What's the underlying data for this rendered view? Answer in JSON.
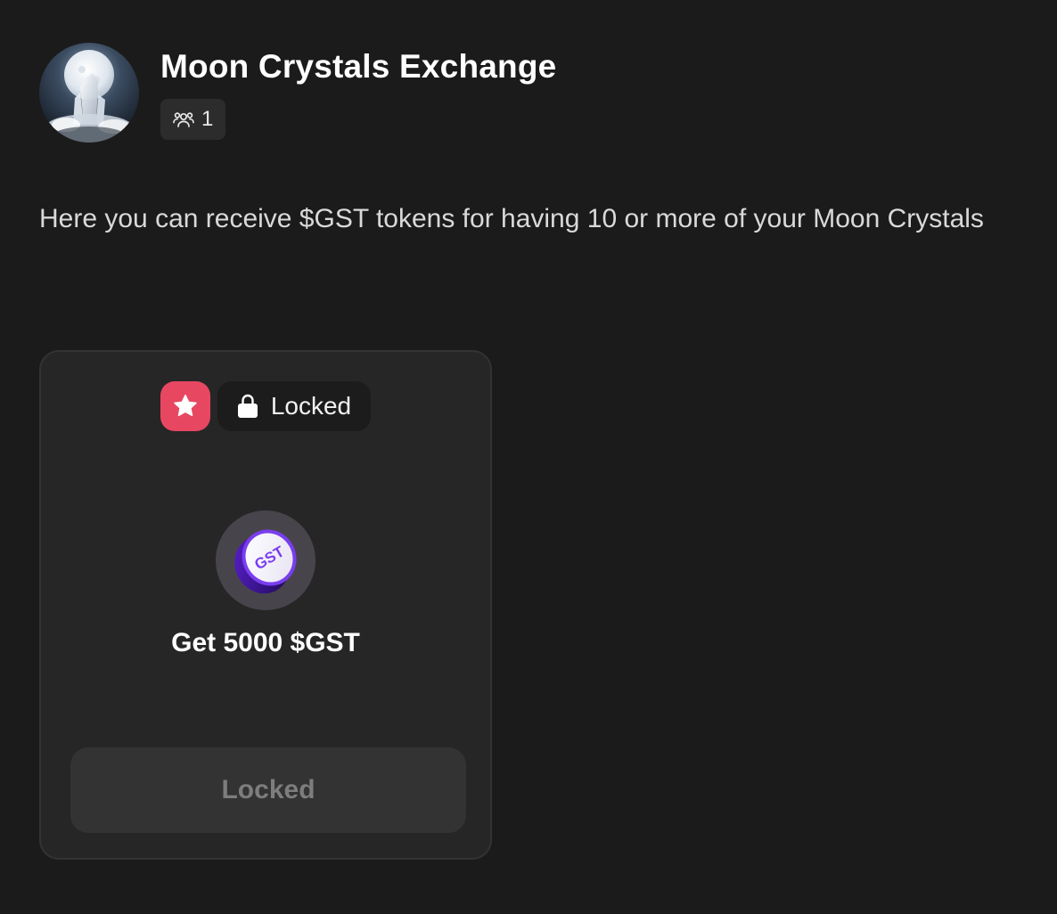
{
  "header": {
    "title": "Moon Crystals Exchange",
    "avatar_icon": "moon-crystal-avatar",
    "members_icon": "members-icon",
    "member_count": "1"
  },
  "description": "Here you can receive $GST tokens for having 10 or more of your Moon Crystals",
  "reward_card": {
    "featured_icon": "star-icon",
    "status_icon": "lock-icon",
    "status_label": "Locked",
    "token_icon": "gst-token-icon",
    "token_logo_text": "GST",
    "reward_title": "Get 5000 $GST",
    "button_label": "Locked"
  },
  "colors": {
    "background": "#1b1b1b",
    "card_background": "#262626",
    "featured_badge": "#e84762",
    "token_purple": "#7a3df0",
    "disabled_text": "#7d7d7d"
  }
}
